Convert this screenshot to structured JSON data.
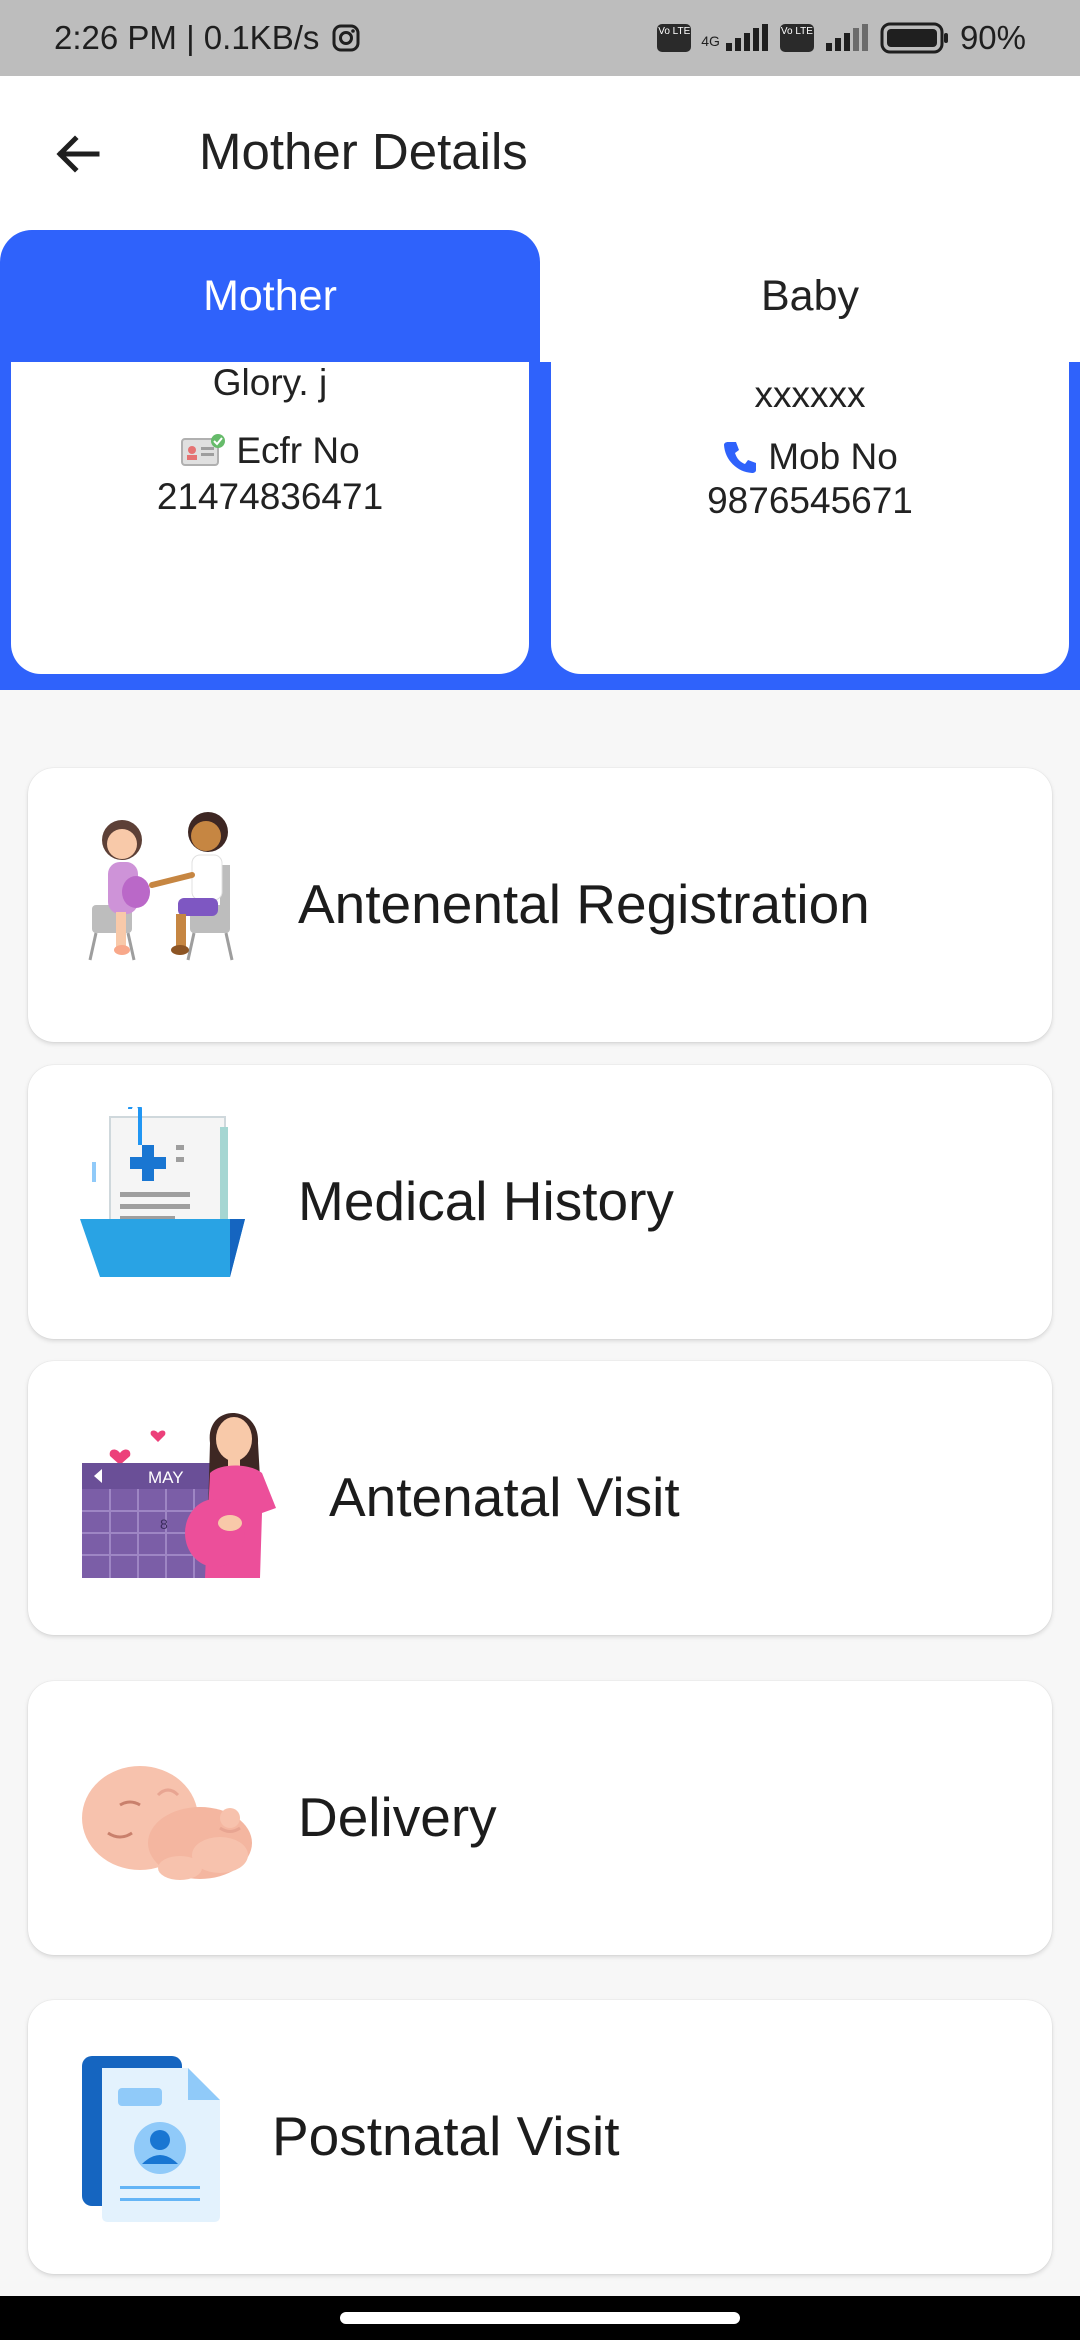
{
  "status_bar": {
    "time_speed": "2:26 PM | 0.1KB/s",
    "network_type": "4G",
    "volte_badge": "Vo LTE",
    "battery": "90%",
    "icons": [
      "instagram-icon",
      "signal-icon",
      "battery-icon"
    ]
  },
  "header": {
    "back_icon": "arrow-left-icon",
    "title": "Mother Details"
  },
  "tabs": [
    {
      "label": "Mother",
      "active": true
    },
    {
      "label": "Baby",
      "active": false
    }
  ],
  "mother_card": {
    "name": "Glory. j",
    "id_label": "Ecfr No",
    "id_value": "21474836471"
  },
  "baby_card": {
    "name": "xxxxxx",
    "mobile_label": "Mob No",
    "mobile_value": "9876545671"
  },
  "menu": [
    {
      "label": "Antenental Registration",
      "icon": "consultation-icon"
    },
    {
      "label": "Medical History",
      "icon": "medical-folder-icon"
    },
    {
      "label": "Antenatal Visit",
      "icon": "pregnancy-calendar-icon",
      "calendar_month": "MAY",
      "calendar_day": "8"
    },
    {
      "label": "Delivery",
      "icon": "newborn-baby-icon"
    },
    {
      "label": "Postnatal Visit",
      "icon": "patient-record-icon"
    }
  ],
  "colors": {
    "primary": "#2f62fb",
    "status_bar": "#bdbdbd",
    "background": "#f7f7f7"
  }
}
